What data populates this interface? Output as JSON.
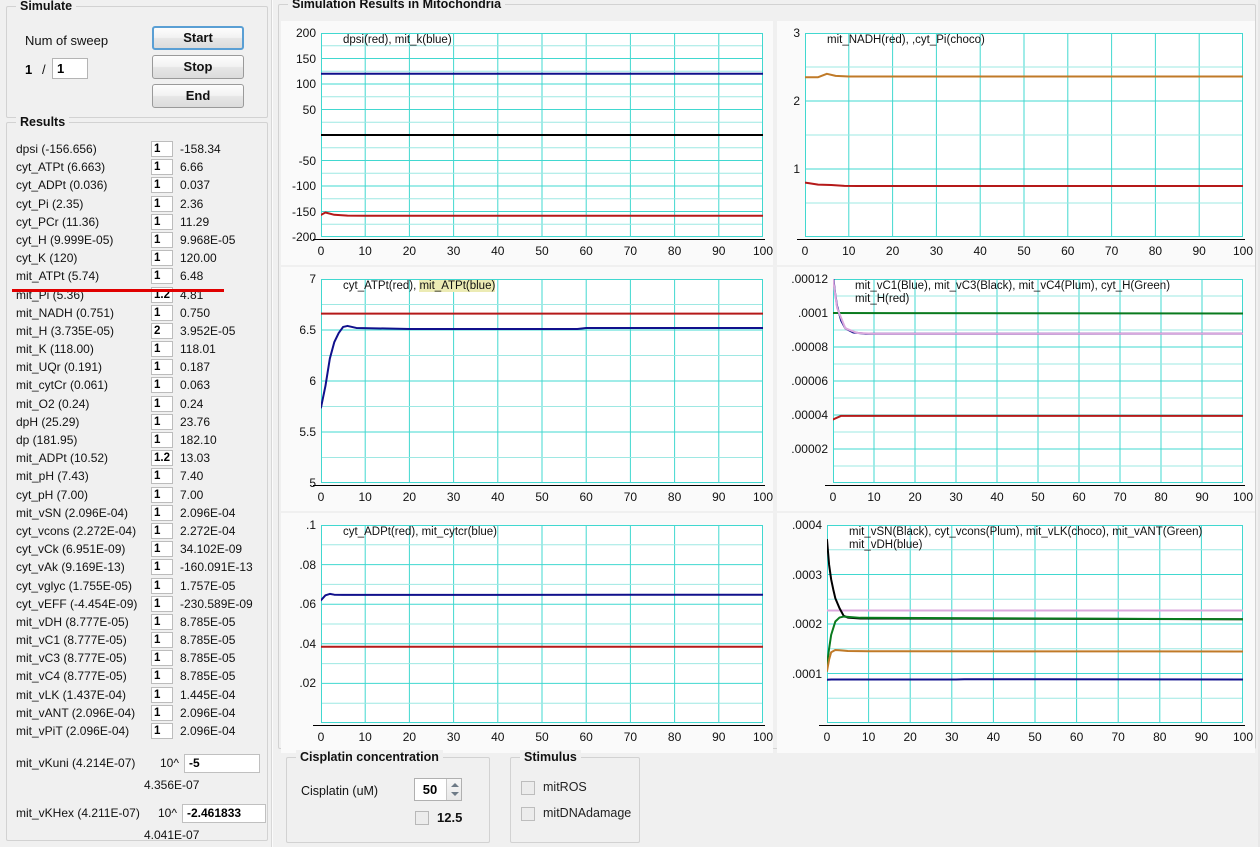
{
  "simulate": {
    "title": "Simulate",
    "num_sweep_label": "Num of sweep",
    "sweep_current": "1",
    "sweep_separator": "/",
    "sweep_total": "1",
    "start_label": "Start",
    "stop_label": "Stop",
    "end_label": "End"
  },
  "results": {
    "title": "Results",
    "rows": [
      {
        "name": "dpsi (-156.656)",
        "factor": "1",
        "value": "-158.34"
      },
      {
        "name": "cyt_ATPt (6.663)",
        "factor": "1",
        "value": "6.66"
      },
      {
        "name": "cyt_ADPt (0.036)",
        "factor": "1",
        "value": "0.037"
      },
      {
        "name": "cyt_Pi (2.35)",
        "factor": "1",
        "value": "2.36"
      },
      {
        "name": "cyt_PCr (11.36)",
        "factor": "1",
        "value": "11.29"
      },
      {
        "name": "cyt_H (9.999E-05)",
        "factor": "1",
        "value": "9.968E-05"
      },
      {
        "name": "cyt_K (120)",
        "factor": "1",
        "value": "120.00"
      },
      {
        "name": "mit_ATPt (5.74)",
        "factor": "1",
        "value": "6.48"
      },
      {
        "name": "mit_Pi (5.36)",
        "factor": "1.2",
        "value": "4.81"
      },
      {
        "name": "mit_NADH (0.751)",
        "factor": "1",
        "value": "0.750"
      },
      {
        "name": "mit_H (3.735E-05)",
        "factor": "2",
        "value": "3.952E-05"
      },
      {
        "name": "mit_K (118.00)",
        "factor": "1",
        "value": "118.01"
      },
      {
        "name": "mit_UQr (0.191)",
        "factor": "1",
        "value": "0.187"
      },
      {
        "name": "mit_cytCr (0.061)",
        "factor": "1",
        "value": "0.063"
      },
      {
        "name": "mit_O2 (0.24)",
        "factor": "1",
        "value": "0.24"
      },
      {
        "name": "dpH (25.29)",
        "factor": "1",
        "value": "23.76"
      },
      {
        "name": "dp (181.95)",
        "factor": "1",
        "value": "182.10"
      },
      {
        "name": "mit_ADPt (10.52)",
        "factor": "1.2",
        "value": "13.03"
      },
      {
        "name": "mit_pH (7.43)",
        "factor": "1",
        "value": "7.40"
      },
      {
        "name": "cyt_pH (7.00)",
        "factor": "1",
        "value": "7.00"
      },
      {
        "name": "mit_vSN (2.096E-04)",
        "factor": "1",
        "value": "2.096E-04"
      },
      {
        "name": "cyt_vcons (2.272E-04)",
        "factor": "1",
        "value": "2.272E-04"
      },
      {
        "name": "cyt_vCk (6.951E-09)",
        "factor": "1",
        "value": "34.102E-09"
      },
      {
        "name": "cyt_vAk (9.169E-13)",
        "factor": "1",
        "value": "-160.091E-13"
      },
      {
        "name": "cyt_vglyc (1.755E-05)",
        "factor": "1",
        "value": "1.757E-05"
      },
      {
        "name": "cyt_vEFF (-4.454E-09)",
        "factor": "1",
        "value": "-230.589E-09"
      },
      {
        "name": "mit_vDH (8.777E-05)",
        "factor": "1",
        "value": "8.785E-05"
      },
      {
        "name": "mit_vC1 (8.777E-05)",
        "factor": "1",
        "value": "8.785E-05"
      },
      {
        "name": "mit_vC3 (8.777E-05)",
        "factor": "1",
        "value": "8.785E-05"
      },
      {
        "name": "mit_vC4 (8.777E-05)",
        "factor": "1",
        "value": "8.785E-05"
      },
      {
        "name": "mit_vLK (1.437E-04)",
        "factor": "1",
        "value": "1.445E-04"
      },
      {
        "name": "mit_vANT (2.096E-04)",
        "factor": "1",
        "value": "2.096E-04"
      },
      {
        "name": "mit_vPiT (2.096E-04)",
        "factor": "1",
        "value": "2.096E-04"
      }
    ],
    "separator_after_row": 7,
    "separator_color": "#e00000",
    "exponent_rows": [
      {
        "name": "mit_vKuni (4.214E-07)",
        "power_label": "10^",
        "exponent": "-5",
        "result": "4.356E-07"
      },
      {
        "name": "mit_vKHex (4.211E-07)",
        "power_label": "10^",
        "exponent": "-2.461833",
        "result": "4.041E-07"
      }
    ]
  },
  "simulation_results": {
    "title": "Simulation Results in Mitochondria"
  },
  "cisplatin": {
    "title": "Cisplatin concentration",
    "field_label": "Cisplatin (uM)",
    "value": "50",
    "half_checkbox_label": "12.5",
    "half_checked": false
  },
  "stimulus": {
    "title": "Stimulus",
    "items": [
      {
        "label": "mitROS",
        "checked": false
      },
      {
        "label": "mitDNAdamage",
        "checked": false
      }
    ]
  },
  "colors": {
    "grid_minor": "#9ee8e3",
    "grid_major": "#41d8d0",
    "red": "#b51919",
    "blue": "#10108c",
    "black": "#000000",
    "green": "#0a7a1e",
    "choco": "#c07a28",
    "plum": "#dba8dd",
    "highlight": "#ecebb4"
  },
  "chart_data": [
    {
      "id": "chart-dpsi-mitk",
      "type": "line",
      "title": "dpsi(red), mit_k(blue)",
      "xlabel": "",
      "ylabel": "",
      "xlim": [
        0,
        100
      ],
      "ylim": [
        -200,
        200
      ],
      "xticks": [
        0,
        10,
        20,
        30,
        40,
        50,
        60,
        70,
        80,
        90,
        100
      ],
      "yticks": [
        -200,
        -150,
        -100,
        -50,
        0,
        50,
        100,
        150,
        200
      ],
      "yticklabels": [
        "-200",
        "-150",
        "-100",
        "-50",
        "",
        "50",
        "100",
        "150",
        "200"
      ],
      "grid": true,
      "series": [
        {
          "name": "mit_k",
          "color": "#10108c",
          "x": [
            0,
            2,
            5,
            10,
            100
          ],
          "values": [
            120.0,
            120.0,
            120.0,
            120.01,
            120.01
          ]
        },
        {
          "name": "zero-axis",
          "color": "#000000",
          "x": [
            0,
            100
          ],
          "values": [
            0,
            0
          ]
        },
        {
          "name": "dpsi",
          "color": "#b51919",
          "x": [
            0,
            1,
            3,
            6,
            10,
            100
          ],
          "values": [
            -156.66,
            -152.0,
            -156.5,
            -158.0,
            -158.3,
            -158.34
          ]
        }
      ]
    },
    {
      "id": "chart-nadh-pi",
      "type": "line",
      "title": "mit_NADH(red), ,cyt_Pi(choco)",
      "xlabel": "",
      "ylabel": "",
      "xlim": [
        0,
        100
      ],
      "ylim": [
        0,
        3
      ],
      "xticks": [
        0,
        10,
        20,
        30,
        40,
        50,
        60,
        70,
        80,
        90,
        100
      ],
      "yticks": [
        1,
        2,
        3
      ],
      "yticklabels": [
        "1",
        "2",
        "3"
      ],
      "grid": true,
      "series": [
        {
          "name": "cyt_Pi",
          "color": "#c07a28",
          "x": [
            0,
            3,
            5,
            7,
            10,
            100
          ],
          "values": [
            2.35,
            2.35,
            2.4,
            2.37,
            2.36,
            2.36
          ]
        },
        {
          "name": "mit_NADH",
          "color": "#b51919",
          "x": [
            0,
            1,
            3,
            6,
            9,
            12,
            100
          ],
          "values": [
            0.8,
            0.79,
            0.77,
            0.765,
            0.752,
            0.75,
            0.75
          ]
        }
      ]
    },
    {
      "id": "chart-atpt",
      "type": "line",
      "title_parts": [
        {
          "text": "cyt_ATPt(red), ",
          "highlight": false
        },
        {
          "text": "mit_ATPt(blue)",
          "highlight": true
        }
      ],
      "title": "cyt_ATPt(red), mit_ATPt(blue)",
      "xlabel": "",
      "ylabel": "",
      "xlim": [
        0,
        100
      ],
      "ylim": [
        5,
        7
      ],
      "xticks": [
        0,
        10,
        20,
        30,
        40,
        50,
        60,
        70,
        80,
        90,
        100
      ],
      "yticks": [
        5,
        5.5,
        6,
        6.5,
        7
      ],
      "yticklabels": [
        "5",
        "5.5",
        "6",
        "6.5",
        "7"
      ],
      "grid": true,
      "series": [
        {
          "name": "cyt_ATPt",
          "color": "#b51919",
          "x": [
            0,
            100
          ],
          "values": [
            6.66,
            6.66
          ]
        },
        {
          "name": "mit_ATPt",
          "color": "#10108c",
          "x": [
            0,
            1,
            2,
            3,
            4,
            5,
            6,
            8,
            20,
            58,
            60,
            100
          ],
          "values": [
            5.74,
            5.95,
            6.22,
            6.38,
            6.47,
            6.53,
            6.54,
            6.52,
            6.51,
            6.51,
            6.52,
            6.52
          ]
        }
      ]
    },
    {
      "id": "chart-vc-h",
      "type": "line",
      "title": "mit_vC1(Blue), mit_vC3(Black), mit_vC4(Plum),  cyt_H(Green) mit_H(red)",
      "title_line1": "mit_vC1(Blue), mit_vC3(Black), mit_vC4(Plum),  cyt_H(Green)",
      "title_line2": "mit_H(red)",
      "xlabel": "",
      "ylabel": "",
      "xlim": [
        0,
        100
      ],
      "ylim": [
        0,
        0.00012
      ],
      "xticks": [
        0,
        10,
        20,
        30,
        40,
        50,
        60,
        70,
        80,
        90,
        100
      ],
      "yticks": [
        2e-05,
        4e-05,
        6e-05,
        8e-05,
        0.0001,
        0.00012
      ],
      "yticklabels": [
        ".00002",
        ".00004",
        ".00006",
        ".00008",
        ".0001",
        ".00012"
      ],
      "grid": true,
      "series": [
        {
          "name": "cyt_H",
          "color": "#0a7a1e",
          "x": [
            0,
            100
          ],
          "values": [
            0.0001,
            9.968e-05
          ]
        },
        {
          "name": "mit_vC1",
          "color": "#10108c",
          "x": [
            0,
            0.5,
            1,
            2,
            3,
            5,
            8,
            12,
            100
          ],
          "values": [
            0.000122,
            0.000112,
            0.000104,
            9.55e-05,
            9.1e-05,
            8.85e-05,
            8.78e-05,
            8.78e-05,
            8.785e-05
          ]
        },
        {
          "name": "mit_vC4",
          "color": "#dba8dd",
          "x": [
            0,
            1,
            3,
            6,
            10,
            100
          ],
          "values": [
            0.00012,
            0.000103,
            9.1e-05,
            8.82e-05,
            8.78e-05,
            8.785e-05
          ]
        },
        {
          "name": "mit_H",
          "color": "#b51919",
          "x": [
            0,
            2,
            5,
            100
          ],
          "values": [
            3.735e-05,
            3.95e-05,
            3.952e-05,
            3.952e-05
          ]
        }
      ]
    },
    {
      "id": "chart-adpt-cytcr",
      "type": "line",
      "title": "cyt_ADPt(red), mit_cytcr(blue)",
      "xlabel": "",
      "ylabel": "",
      "xlim": [
        0,
        100
      ],
      "ylim": [
        0,
        0.1
      ],
      "xticks": [
        0,
        10,
        20,
        30,
        40,
        50,
        60,
        70,
        80,
        90,
        100
      ],
      "yticks": [
        0.02,
        0.04,
        0.06,
        0.08,
        0.1
      ],
      "yticklabels": [
        ".02",
        ".04",
        ".06",
        ".08",
        ".1"
      ],
      "grid": true,
      "series": [
        {
          "name": "mit_cytcr",
          "color": "#10108c",
          "x": [
            0,
            1,
            2,
            3,
            5,
            10,
            100
          ],
          "values": [
            0.062,
            0.0645,
            0.0652,
            0.0648,
            0.0647,
            0.0647,
            0.0648
          ]
        },
        {
          "name": "cyt_ADPt",
          "color": "#b51919",
          "x": [
            0,
            100
          ],
          "values": [
            0.0385,
            0.0385
          ]
        }
      ]
    },
    {
      "id": "chart-fluxes",
      "type": "line",
      "title": "mit_vSN(Black), cyt_vcons(Plum), mit_vLK(choco), mit_vANT(Green) mit_vDH(blue)",
      "title_line1": "mit_vSN(Black), cyt_vcons(Plum), mit_vLK(choco), mit_vANT(Green)",
      "title_line2": "mit_vDH(blue)",
      "xlabel": "",
      "ylabel": "",
      "xlim": [
        0,
        100
      ],
      "ylim": [
        0,
        0.0004
      ],
      "xticks": [
        0,
        10,
        20,
        30,
        40,
        50,
        60,
        70,
        80,
        90,
        100
      ],
      "yticks": [
        0.0001,
        0.0002,
        0.0003,
        0.0004
      ],
      "yticklabels": [
        ".0001",
        ".0002",
        ".0003",
        ".0004"
      ],
      "grid": true,
      "series": [
        {
          "name": "cyt_vcons",
          "color": "#dba8dd",
          "x": [
            0,
            100
          ],
          "values": [
            0.0002272,
            0.0002272
          ]
        },
        {
          "name": "mit_vSN",
          "color": "#000000",
          "x": [
            0,
            0.5,
            1,
            1.5,
            2,
            3,
            4,
            5,
            8,
            100
          ],
          "values": [
            0.00037,
            0.00032,
            0.00029,
            0.00027,
            0.000252,
            0.000232,
            0.0002165,
            0.000213,
            0.0002112,
            0.0002096
          ]
        },
        {
          "name": "mit_vANT",
          "color": "#0a7a1e",
          "x": [
            0,
            0.5,
            1,
            2,
            3,
            4,
            5,
            8,
            100
          ],
          "values": [
            0.000118,
            0.00015,
            0.000178,
            0.000205,
            0.000213,
            0.000215,
            0.0002145,
            0.0002125,
            0.0002096
          ]
        },
        {
          "name": "mit_vLK",
          "color": "#c07a28",
          "x": [
            0,
            0.5,
            1,
            2,
            3,
            5,
            10,
            100
          ],
          "values": [
            0.000105,
            0.000128,
            0.000143,
            0.0001475,
            0.000147,
            0.0001455,
            0.000145,
            0.0001445
          ]
        },
        {
          "name": "mit_vDH",
          "color": "#10108c",
          "x": [
            0,
            1,
            3,
            10,
            20,
            31,
            33,
            50,
            100
          ],
          "values": [
            8.75e-05,
            8.78e-05,
            8.8e-05,
            8.8e-05,
            8.8e-05,
            8.8e-05,
            8.85e-05,
            8.85e-05,
            8.785e-05
          ]
        }
      ]
    }
  ]
}
